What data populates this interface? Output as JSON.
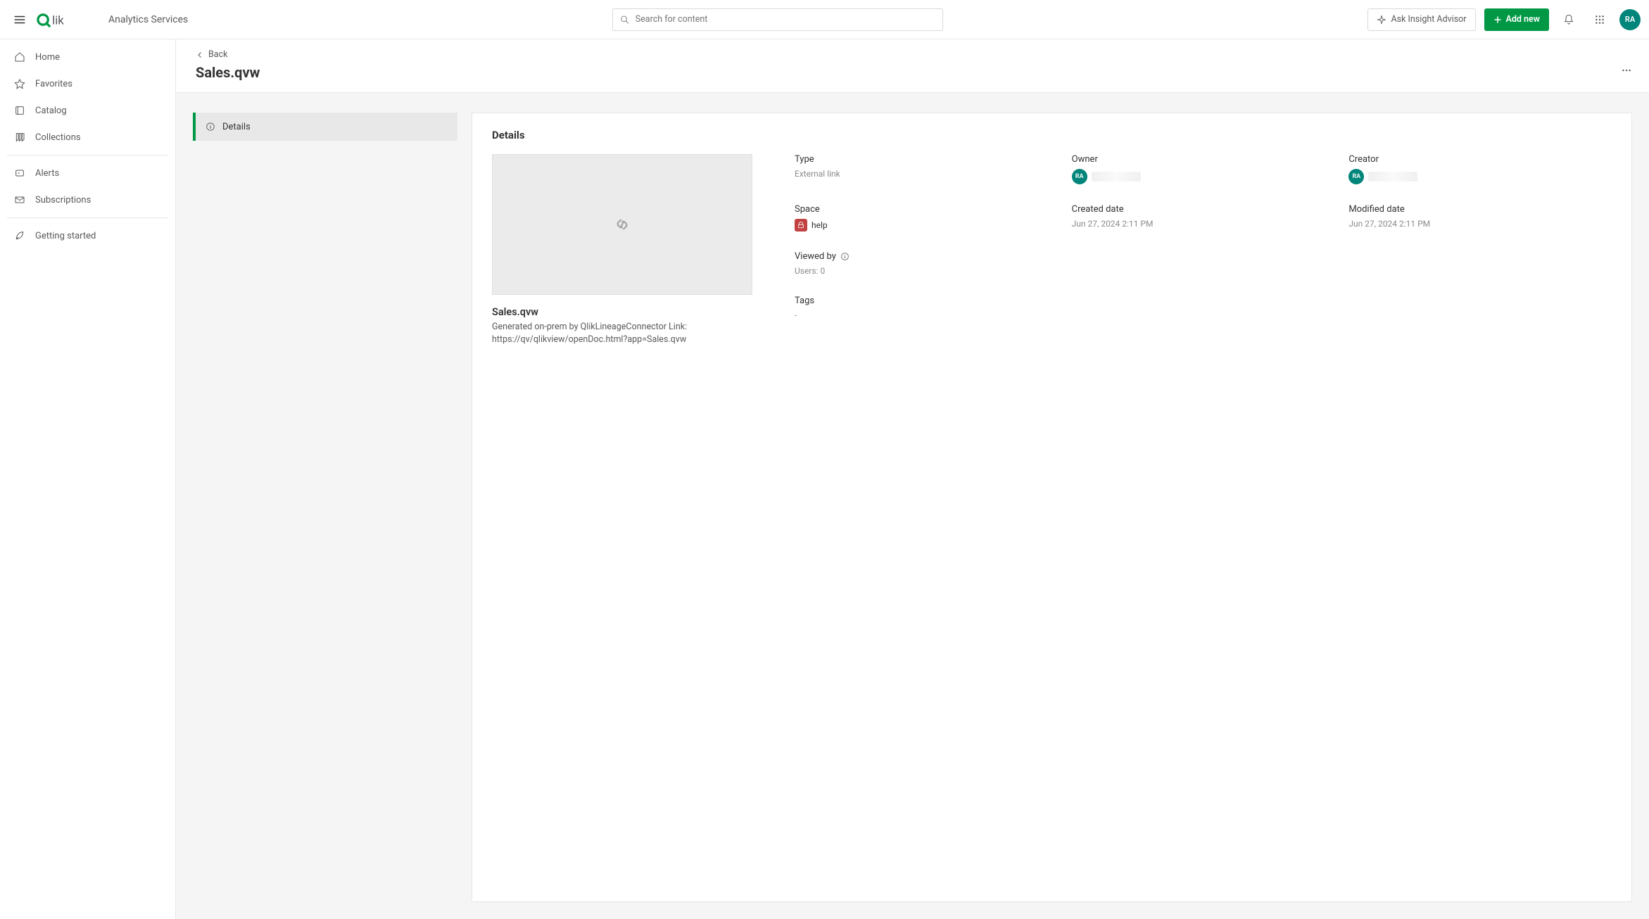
{
  "header": {
    "product": "Analytics Services",
    "search_placeholder": "Search for content",
    "ask_insight": "Ask Insight Advisor",
    "add_new": "Add new",
    "user_initials": "RA"
  },
  "sidebar": {
    "items": [
      {
        "id": "home",
        "label": "Home"
      },
      {
        "id": "favorites",
        "label": "Favorites"
      },
      {
        "id": "catalog",
        "label": "Catalog"
      },
      {
        "id": "collections",
        "label": "Collections"
      },
      {
        "id": "alerts",
        "label": "Alerts"
      },
      {
        "id": "subscriptions",
        "label": "Subscriptions"
      },
      {
        "id": "getting-started",
        "label": "Getting started"
      }
    ]
  },
  "page": {
    "back": "Back",
    "title": "Sales.qvw"
  },
  "side_tabs": {
    "details": "Details"
  },
  "panel": {
    "heading": "Details",
    "file_name": "Sales.qvw",
    "file_desc": "Generated on-prem by QlikLineageConnector Link: https://qv/qlikview/openDoc.html?app=Sales.qvw",
    "labels": {
      "type": "Type",
      "owner": "Owner",
      "creator": "Creator",
      "space": "Space",
      "created": "Created date",
      "modified": "Modified date",
      "viewed_by": "Viewed by",
      "tags": "Tags"
    },
    "values": {
      "type": "External link",
      "space": "help",
      "created": "Jun 27, 2024 2:11 PM",
      "modified": "Jun 27, 2024 2:11 PM",
      "viewed_by": "Users: 0",
      "tags": "-",
      "owner_initials": "RA",
      "creator_initials": "RA"
    }
  }
}
